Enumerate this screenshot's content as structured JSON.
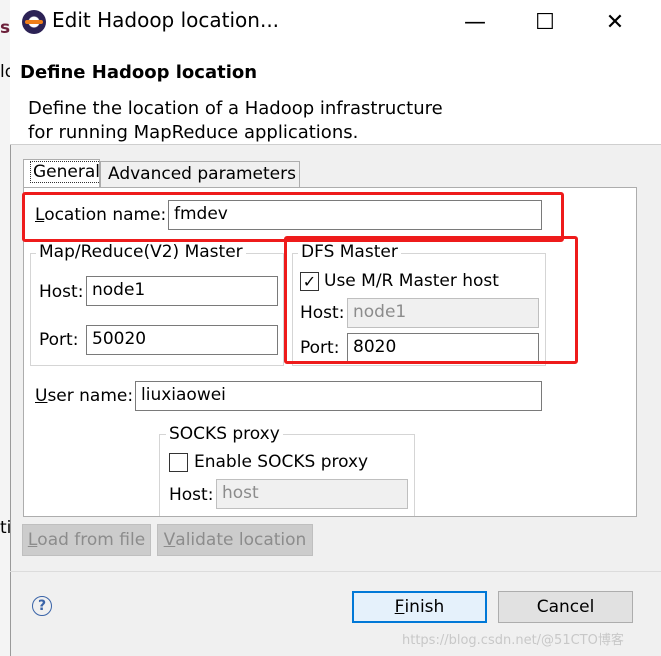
{
  "window": {
    "title": "Edit Hadoop location...",
    "minimize_glyph": "—",
    "maximize_glyph": "☐",
    "close_glyph": "✕"
  },
  "background": {
    "left_fragments": [
      "sr",
      "ld",
      "ti"
    ]
  },
  "header": {
    "title": "Define Hadoop location",
    "description": "Define the location of a Hadoop infrastructure for running MapReduce applications."
  },
  "tabs": {
    "general": "General",
    "advanced": "Advanced parameters"
  },
  "location": {
    "label_first": "L",
    "label_rest": "ocation name:",
    "value": "fmdev"
  },
  "mr_master": {
    "title": "Map/Reduce(V2) Master",
    "host_label": "Host:",
    "host_value": "node1",
    "port_label": "Port:",
    "port_value": "50020"
  },
  "dfs_master": {
    "title": "DFS Master",
    "use_mr_label": "Use M/R Master host",
    "use_mr_checked": "✓",
    "host_label": "Host:",
    "host_value": "node1",
    "port_label": "Port:",
    "port_value": "8020"
  },
  "user": {
    "label_first": "U",
    "label_rest": "ser name:",
    "value": "liuxiaowei"
  },
  "socks": {
    "title": "SOCKS proxy",
    "enable_label": "Enable SOCKS proxy",
    "host_label": "Host:",
    "host_value": "host"
  },
  "buttons": {
    "load_first": "L",
    "load_rest": "oad from file",
    "validate_first": "V",
    "validate_rest": "alidate location",
    "finish_first": "F",
    "finish_rest": "inish",
    "cancel": "Cancel",
    "help": "?"
  },
  "watermark": "https://blog.csdn.net/@51CTO博客",
  "colors": {
    "highlight": "#ee1b1b",
    "focus": "#0078d7"
  }
}
